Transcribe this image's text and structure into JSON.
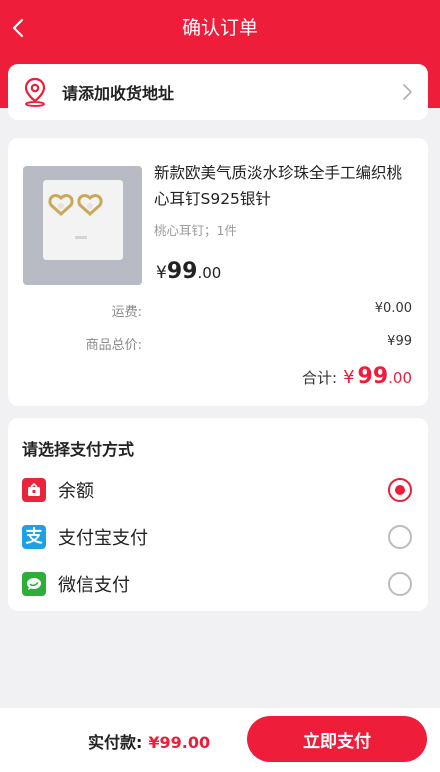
{
  "header": {
    "title": "确认订单"
  },
  "address": {
    "placeholder_text": "请添加收货地址"
  },
  "product": {
    "title": "新款欧美气质淡水珍珠全手工编织桃心耳钉S925银针",
    "spec": "桃心耳钉；1件",
    "price_symbol": "¥",
    "price_int": "99",
    "price_dec": ".00"
  },
  "summary": {
    "shipping_label": "运费:",
    "shipping_value": "¥0.00",
    "goods_total_label": "商品总价:",
    "goods_total_value": "¥99",
    "total_label": "合计:",
    "total_symbol": "¥",
    "total_int": "99",
    "total_dec": ".00"
  },
  "payment": {
    "title": "请选择支付方式",
    "options": [
      {
        "label": "余额",
        "icon": "wallet-icon",
        "color": "#e8253a",
        "selected": true
      },
      {
        "label": "支付宝支付",
        "icon": "alipay-icon",
        "color": "#1f9fe6",
        "selected": false
      },
      {
        "label": "微信支付",
        "icon": "wechat-icon",
        "color": "#2cae38",
        "selected": false
      }
    ]
  },
  "footer": {
    "amount_label": "实付款:",
    "amount_value": "¥99.00",
    "pay_button": "立即支付"
  },
  "colors": {
    "accent": "#ee1d3a",
    "background": "#f1f1f3"
  }
}
